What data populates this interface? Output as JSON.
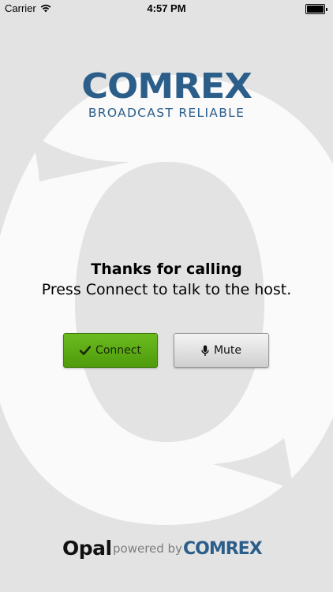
{
  "status_bar": {
    "carrier": "Carrier",
    "time": "4:57 PM"
  },
  "logo": {
    "brand": "COMREX",
    "tagline": "BROADCAST RELIABLE"
  },
  "message": {
    "title": "Thanks for calling",
    "subtitle": "Press Connect to talk to the host."
  },
  "buttons": {
    "connect_label": "Connect",
    "mute_label": "Mute"
  },
  "footer": {
    "app_name": "Opal",
    "powered_by": "powered by",
    "brand": "COMREX"
  },
  "colors": {
    "brand_blue": "#2c5e8a",
    "connect_green": "#5aa814",
    "background": "#e3e3e3"
  }
}
